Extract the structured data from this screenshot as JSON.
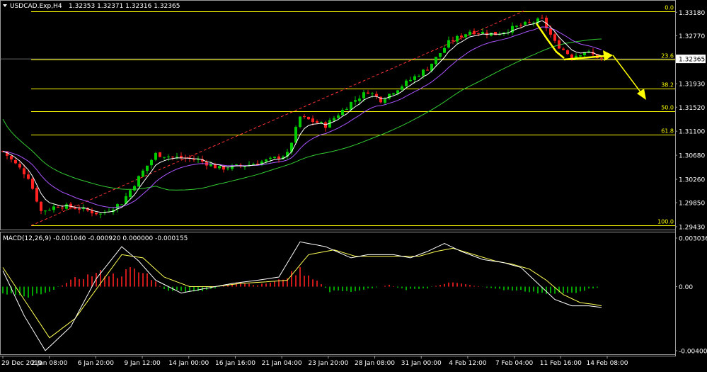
{
  "header": {
    "symbol_text": "USDCAD.Exp,H4",
    "ohlc_text": "1.32353 1.32371 1.32316 1.32365"
  },
  "macd": {
    "label": "MACD(12,26,9) -0.001040 -0.000920 0.000000 -0.000155"
  },
  "colors": {
    "background": "#000000",
    "bull": "#00cc00",
    "bear": "#ff2020",
    "fib": "#ffff00",
    "ma_fast": "#ffffff",
    "ma_mid": "#aa55ff",
    "ma_slow": "#33cc33",
    "signal": "#ffff55",
    "trend": "#ff3333"
  },
  "chart_data": [
    {
      "type": "candlestick",
      "symbol": "USDCAD",
      "timeframe": "H4",
      "last_price": "1.32365",
      "x_ticks": [
        "29 Dec 2019",
        "2 Jan 08:00",
        "6 Jan 20:00",
        "9 Jan 12:00",
        "14 Jan 00:00",
        "16 Jan 16:00",
        "21 Jan 04:00",
        "23 Jan 20:00",
        "28 Jan 08:00",
        "31 Jan 00:00",
        "4 Feb 12:00",
        "7 Feb 04:00",
        "11 Feb 16:00",
        "14 Feb 08:00"
      ],
      "y_ticks": [
        "1.33180",
        "1.32770",
        "1.32365",
        "1.31930",
        "1.31520",
        "1.31100",
        "1.30680",
        "1.30260",
        "1.29850",
        "1.29430"
      ],
      "ylim": [
        1.2938,
        1.3337
      ],
      "fibonacci": [
        {
          "level": "0.0",
          "price": 1.332
        },
        {
          "level": "23.6",
          "price": 1.3236
        },
        {
          "level": "38.2",
          "price": 1.3185
        },
        {
          "level": "50.0",
          "price": 1.3145
        },
        {
          "level": "61.8",
          "price": 1.3104
        },
        {
          "level": "100.0",
          "price": 1.2945
        }
      ],
      "waypoints": [
        [
          0,
          1.3075
        ],
        [
          6,
          1.303
        ],
        [
          9,
          1.297
        ],
        [
          13,
          1.298
        ],
        [
          18,
          1.2975
        ],
        [
          23,
          1.2965
        ],
        [
          28,
          1.2985
        ],
        [
          33,
          1.304
        ],
        [
          36,
          1.307
        ],
        [
          40,
          1.3065
        ],
        [
          46,
          1.306
        ],
        [
          51,
          1.3045
        ],
        [
          57,
          1.305
        ],
        [
          63,
          1.306
        ],
        [
          67,
          1.307
        ],
        [
          70,
          1.3135
        ],
        [
          76,
          1.312
        ],
        [
          82,
          1.316
        ],
        [
          86,
          1.318
        ],
        [
          89,
          1.3165
        ],
        [
          95,
          1.3195
        ],
        [
          100,
          1.322
        ],
        [
          105,
          1.3265
        ],
        [
          110,
          1.3285
        ],
        [
          116,
          1.328
        ],
        [
          122,
          1.3295
        ],
        [
          127,
          1.3305
        ],
        [
          130,
          1.3265
        ],
        [
          134,
          1.324
        ],
        [
          137,
          1.325
        ],
        [
          141,
          1.3237
        ]
      ]
    },
    {
      "type": "line",
      "indicator": "MACD(12,26,9)",
      "y_ticks": [
        "0.003036",
        "0.00",
        "-0.004007"
      ],
      "ylim": [
        -0.004007,
        0.003036
      ],
      "hist_waypoints": [
        [
          0,
          -0.0004
        ],
        [
          6,
          -0.0006
        ],
        [
          11,
          -0.0003
        ],
        [
          17,
          0.0005
        ],
        [
          23,
          0.0009
        ],
        [
          27,
          0.0007
        ],
        [
          30,
          0.0011
        ],
        [
          34,
          0.0008
        ],
        [
          38,
          -0.0002
        ],
        [
          44,
          -0.0004
        ],
        [
          50,
          -0.0001
        ],
        [
          55,
          0.0003
        ],
        [
          60,
          0.0001
        ],
        [
          65,
          0.0004
        ],
        [
          70,
          0.0011
        ],
        [
          73,
          0.0006
        ],
        [
          77,
          -0.0003
        ],
        [
          82,
          -0.0003
        ],
        [
          87,
          -0.0001
        ],
        [
          91,
          0.0001
        ],
        [
          95,
          -0.0002
        ],
        [
          100,
          -0.0001
        ],
        [
          105,
          0.0003
        ],
        [
          110,
          0.0001
        ],
        [
          118,
          -0.0002
        ],
        [
          124,
          -0.0003
        ],
        [
          129,
          -0.0005
        ],
        [
          134,
          -0.0004
        ],
        [
          139,
          -0.0001
        ],
        [
          141,
          0.0
        ]
      ],
      "main_waypoints": [
        [
          0,
          0.001
        ],
        [
          5,
          -0.0018
        ],
        [
          10,
          -0.004
        ],
        [
          16,
          -0.0025
        ],
        [
          22,
          0.0005
        ],
        [
          28,
          0.0025
        ],
        [
          32,
          0.0016
        ],
        [
          36,
          0.0004
        ],
        [
          42,
          -0.0004
        ],
        [
          48,
          -0.0001
        ],
        [
          54,
          0.0002
        ],
        [
          60,
          0.0004
        ],
        [
          65,
          0.0006
        ],
        [
          70,
          0.0028
        ],
        [
          76,
          0.0025
        ],
        [
          82,
          0.0018
        ],
        [
          86,
          0.002
        ],
        [
          92,
          0.002
        ],
        [
          96,
          0.0018
        ],
        [
          100,
          0.0022
        ],
        [
          104,
          0.0027
        ],
        [
          108,
          0.0022
        ],
        [
          113,
          0.0017
        ],
        [
          118,
          0.0015
        ],
        [
          122,
          0.0012
        ],
        [
          126,
          0.0002
        ],
        [
          130,
          -0.0008
        ],
        [
          134,
          -0.0012
        ],
        [
          138,
          -0.0012
        ],
        [
          141,
          -0.0013
        ]
      ],
      "signal_waypoints": [
        [
          0,
          0.0012
        ],
        [
          6,
          -0.0012
        ],
        [
          11,
          -0.0032
        ],
        [
          17,
          -0.002
        ],
        [
          23,
          0.0002
        ],
        [
          28,
          0.002
        ],
        [
          33,
          0.0018
        ],
        [
          38,
          0.0006
        ],
        [
          44,
          0.0
        ],
        [
          50,
          0.0
        ],
        [
          56,
          0.0002
        ],
        [
          62,
          0.0003
        ],
        [
          67,
          0.0004
        ],
        [
          72,
          0.002
        ],
        [
          78,
          0.0023
        ],
        [
          83,
          0.0019
        ],
        [
          88,
          0.0019
        ],
        [
          93,
          0.0019
        ],
        [
          98,
          0.0019
        ],
        [
          102,
          0.0022
        ],
        [
          106,
          0.0024
        ],
        [
          111,
          0.002
        ],
        [
          116,
          0.0016
        ],
        [
          120,
          0.0014
        ],
        [
          124,
          0.0011
        ],
        [
          128,
          0.0004
        ],
        [
          132,
          -0.0005
        ],
        [
          136,
          -0.001
        ],
        [
          139,
          -0.0011
        ],
        [
          141,
          -0.0012
        ]
      ]
    }
  ]
}
